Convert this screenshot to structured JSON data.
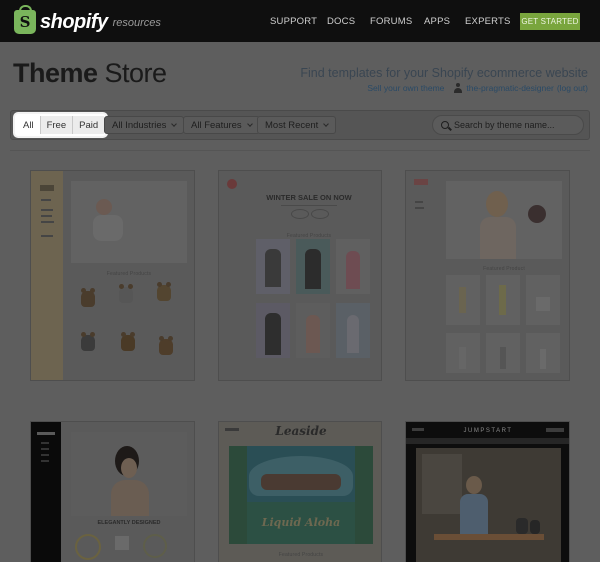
{
  "topbar": {
    "logo_text": "shopify",
    "logo_sub": "resources",
    "nav": [
      {
        "label": "SUPPORT"
      },
      {
        "label": "DOCS"
      },
      {
        "label": "FORUMS"
      },
      {
        "label": "APPS"
      },
      {
        "label": "EXPERTS"
      }
    ],
    "cta_label": "GET STARTED",
    "colors": {
      "bar": "#0f0f0f",
      "cta": "#79a53d",
      "brand_bag": "#7ab55c"
    }
  },
  "header": {
    "title_bold": "Theme",
    "title_light": " Store",
    "tagline": "Find templates for your Shopify ecommerce website",
    "sell_link": "Sell your own theme",
    "user_link": "the-pragmatic-designer",
    "logout_link": "(log out)"
  },
  "filters": {
    "price": [
      {
        "label": "All",
        "active": true
      },
      {
        "label": "Free",
        "active": false
      },
      {
        "label": "Paid",
        "active": false
      }
    ],
    "industries": "All Industries",
    "features": "All Features",
    "sort": "Most Recent",
    "search_placeholder": "Search by theme name..."
  },
  "themes": [
    {
      "caption1": "Featured Products"
    },
    {
      "banner": "WINTER SALE ON NOW",
      "caption1": "Featured Products"
    },
    {
      "caption1": "Featured Product"
    },
    {
      "heading": "ELEGANTLY DESIGNED"
    },
    {
      "logo": "Leaside",
      "banner": "Liquid Aloha",
      "caption1": "Featured Products"
    },
    {
      "logo": "JUMPSTART"
    }
  ]
}
